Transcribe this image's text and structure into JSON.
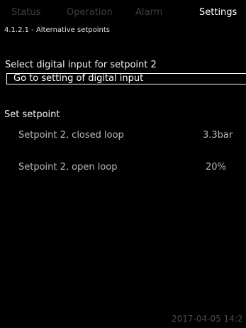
{
  "tabs": [
    {
      "label": "Status"
    },
    {
      "label": "Operation"
    },
    {
      "label": "Alarm"
    },
    {
      "label": "Settings"
    }
  ],
  "active_tab": "Settings",
  "breadcrumb": "4.1.2.1 - Alternative setpoints",
  "digital_input": {
    "label": "Select digital input for setpoint 2",
    "button_label": "Go to setting of digital input"
  },
  "setpoints": {
    "title": "Set setpoint",
    "closed_loop": {
      "label": "Setpoint 2, closed loop",
      "value": "3.3bar"
    },
    "open_loop": {
      "label": "Setpoint 2, open loop",
      "value": "20%"
    }
  },
  "datetime": "2017-04-05 14:2"
}
